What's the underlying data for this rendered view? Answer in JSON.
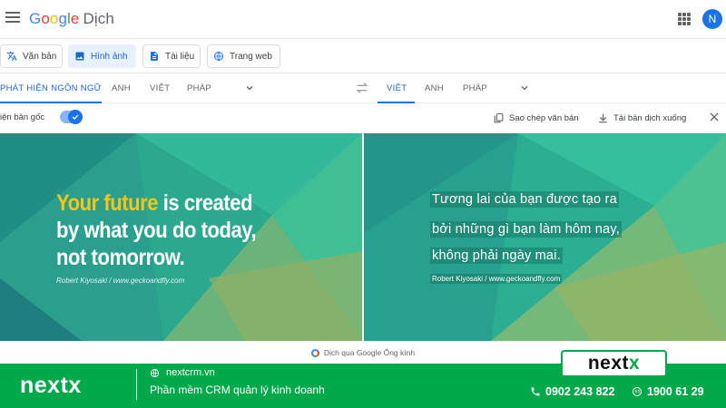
{
  "header": {
    "logo_parts": [
      "G",
      "o",
      "o",
      "g",
      "l",
      "e"
    ],
    "product": "Dịch",
    "avatar_letter": "N"
  },
  "modes": [
    {
      "label": "Văn bản",
      "icon": "translate-icon"
    },
    {
      "label": "Hình ảnh",
      "icon": "image-icon",
      "active": true
    },
    {
      "label": "Tài liệu",
      "icon": "document-icon"
    },
    {
      "label": "Trang web",
      "icon": "globe-icon"
    }
  ],
  "source_langs": [
    "PHÁT HIỆN NGÔN NGỮ",
    "ANH",
    "VIỆT",
    "PHÁP"
  ],
  "target_langs": [
    "VIỆT",
    "ANH",
    "PHÁP"
  ],
  "options": {
    "show_original": "iện bản gốc",
    "copy_text": "Sao chép văn bản",
    "download": "Tải bản dịch xuống"
  },
  "original_image": {
    "quote_highlight": "Your future",
    "quote_rest_1": " is created",
    "quote_line_2": "by what you do today,",
    "quote_line_3": "not tomorrow.",
    "author": "Robert Kiyosaki  /  www.geckoandfly.com"
  },
  "translated_image": {
    "lines": [
      "Tương lai của bạn được tạo ra",
      "bởi những gì bạn làm hôm nay,",
      "không phải ngày mai."
    ],
    "author": "Robert Kiyosaki / www.geckoandfly.com"
  },
  "lens_note": "Dịch qua Google Ống kính",
  "footer": {
    "brand": "nextx",
    "site": "nextcrm.vn",
    "tagline": "Phần mềm CRM quản lý kinh doanh",
    "phone_1": "0902 243 822",
    "phone_2": "1900 61 29",
    "badge_text_a": "next",
    "badge_text_b": "x"
  },
  "colors": {
    "accent": "#1a73e8",
    "footer_green": "#02a94a",
    "teal_bg": "#2aa98f"
  }
}
